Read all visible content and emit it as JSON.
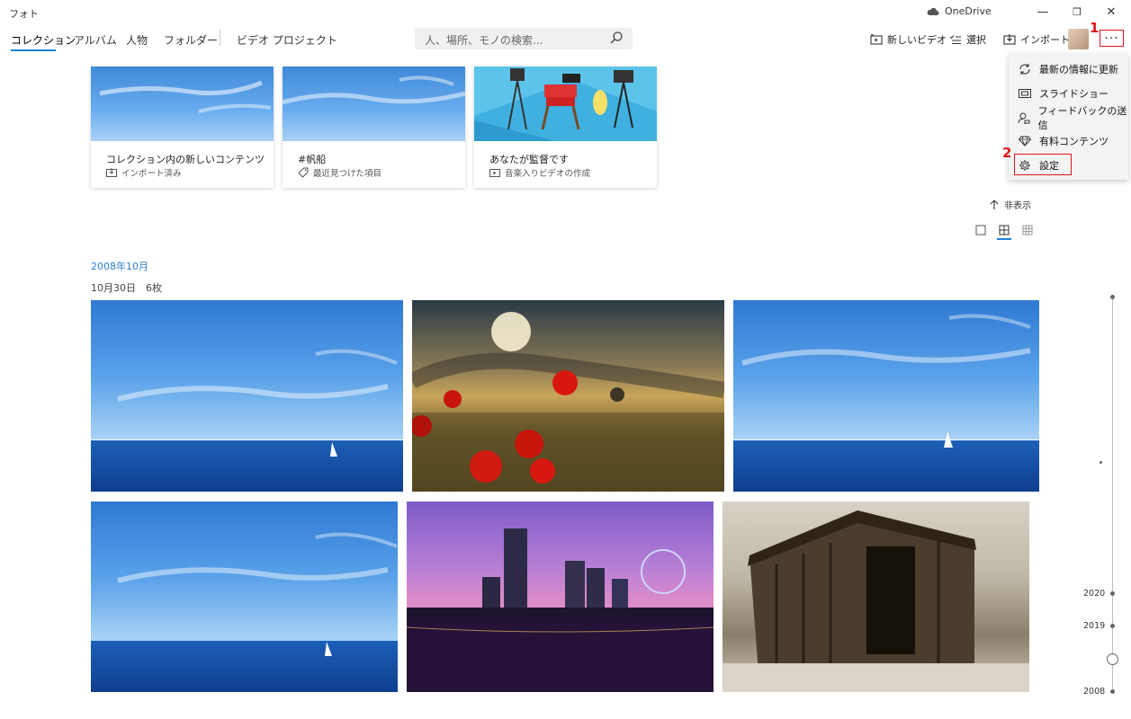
{
  "app": {
    "title": "フォト",
    "onedrive": "OneDrive"
  },
  "window": {
    "minimize": "—",
    "restore": "❐",
    "close": "✕"
  },
  "nav": {
    "tabs": [
      "コレクション",
      "アルバム",
      "人物",
      "フォルダー",
      "ビデオ プロジェクト"
    ],
    "active_index": 0
  },
  "search": {
    "placeholder": "人、場所、モノの検索..."
  },
  "toolbar": {
    "new_video": "新しいビデオ",
    "select": "選択",
    "import": "インポート",
    "more": "···"
  },
  "annotations": {
    "step1": "1",
    "step2": "2"
  },
  "menu": {
    "items": [
      {
        "label": "最新の情報に更新",
        "icon": "refresh-icon"
      },
      {
        "label": "スライドショー",
        "icon": "slideshow-icon"
      },
      {
        "label": "フィードバックの送信",
        "icon": "feedback-icon"
      },
      {
        "label": "有料コンテンツ",
        "icon": "diamond-icon"
      },
      {
        "label": "設定",
        "icon": "gear-icon"
      }
    ]
  },
  "cards": [
    {
      "title": "コレクション内の新しいコンテンツ",
      "subtitle": "インポート済み",
      "icon": "import-icon"
    },
    {
      "title": "#帆船",
      "subtitle": "最近見つけた項目",
      "icon": "tag-icon"
    },
    {
      "title": "あなたが監督です",
      "subtitle": "音楽入りビデオの作成",
      "icon": "video-icon"
    }
  ],
  "hide_link": "非表示",
  "gallery": {
    "month": "2008年10月",
    "day_label": "10月30日　6枚"
  },
  "timeline": {
    "years": [
      "2020",
      "2019",
      "2008"
    ]
  },
  "colors": {
    "accent": "#1e7fd8",
    "annotation_red": "#e0141b",
    "menu_bg": "#f3f3f3"
  }
}
